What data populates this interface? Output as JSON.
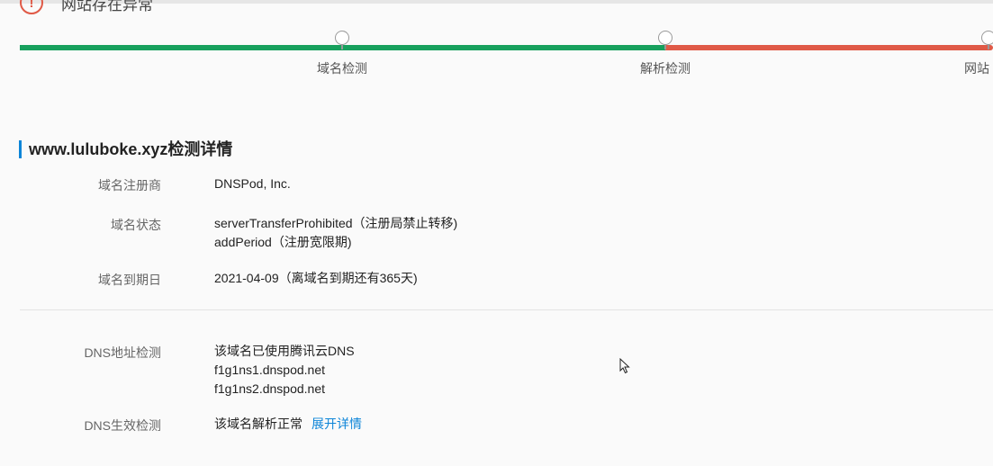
{
  "status": {
    "text": "网站存在异常"
  },
  "steps": [
    {
      "label": "域名检测"
    },
    {
      "label": "解析检测"
    },
    {
      "label": "网站"
    }
  ],
  "progress": {
    "passed_color": "#17a05d",
    "failed_color": "#e05a47"
  },
  "section": {
    "title": "www.luluboke.xyz检测详情"
  },
  "details": {
    "registrar": {
      "label": "域名注册商",
      "value": "DNSPod, Inc."
    },
    "status": {
      "label": "域名状态",
      "lines": [
        "serverTransferProhibited（注册局禁止转移)",
        "addPeriod（注册宽限期)"
      ]
    },
    "expiry": {
      "label": "域名到期日",
      "value": "2021-04-09（离域名到期还有365天)"
    },
    "dns_address": {
      "label": "DNS地址检测",
      "lines": [
        "该域名已使用腾讯云DNS",
        "f1g1ns1.dnspod.net",
        "f1g1ns2.dnspod.net"
      ]
    },
    "dns_effect": {
      "label": "DNS生效检测",
      "value": "该域名解析正常",
      "link": "展开详情"
    }
  }
}
